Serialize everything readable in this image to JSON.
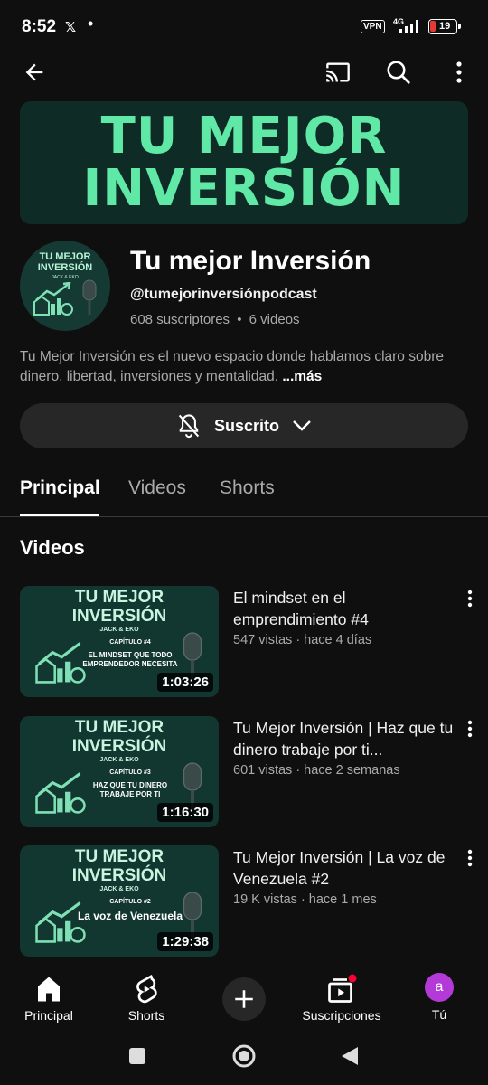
{
  "status_bar": {
    "time": "8:52",
    "x_label": "𝕏",
    "dot": "•",
    "vpn": "VPN",
    "network": "4G",
    "battery": "19",
    "battery_color": "#e53935"
  },
  "top_bar": {
    "icons": [
      "back-arrow-icon",
      "cast-icon",
      "search-icon",
      "more-vert-icon"
    ]
  },
  "banner": {
    "line1": "TU MEJOR",
    "line2": "INVERSIÓN",
    "text_color": "#5fe8a6"
  },
  "channel": {
    "avatar_line1": "TU MEJOR",
    "avatar_line2": "INVERSIÓN",
    "avatar_line3": "JACK & EKO",
    "name": "Tu mejor Inversión",
    "handle": "@tumejorinversiónpodcast",
    "subscribers": "608 suscriptores",
    "separator": "•",
    "videos_count": "6 videos",
    "description": "Tu Mejor Inversión es el nuevo espacio donde hablamos claro sobre dinero, libertad, inversiones y mentalidad.",
    "more": "...más"
  },
  "subscribe": {
    "label": "Suscrito"
  },
  "tabs": [
    {
      "label": "Principal",
      "active": true
    },
    {
      "label": "Videos",
      "active": false
    },
    {
      "label": "Shorts",
      "active": false
    }
  ],
  "section_title": "Videos",
  "videos": [
    {
      "title": "El mindset en el emprendimiento #4",
      "meta": "547 vistas · hace 4 días",
      "duration": "1:03:26",
      "thumb_line1": "TU MEJOR",
      "thumb_line2": "INVERSIÓN",
      "thumb_sub": "JACK & EKO",
      "thumb_chapter": "CAPÍTULO #4",
      "thumb_topic": "EL MINDSET QUE TODO EMPRENDEDOR NECESITA"
    },
    {
      "title": "Tu Mejor Inversión | Haz que tu dinero trabaje por ti...",
      "meta": "601 vistas · hace 2 semanas",
      "duration": "1:16:30",
      "thumb_line1": "TU MEJOR",
      "thumb_line2": "INVERSIÓN",
      "thumb_sub": "JACK & EKO",
      "thumb_chapter": "CAPÍTULO #3",
      "thumb_topic": "HAZ QUE TU DINERO TRABAJE POR TI"
    },
    {
      "title": "Tu Mejor Inversión | La voz de Venezuela #2",
      "meta": "19 K vistas · hace 1 mes",
      "duration": "1:29:38",
      "thumb_line1": "TU MEJOR",
      "thumb_line2": "INVERSIÓN",
      "thumb_sub": "JACK & EKO",
      "thumb_chapter": "CAPÍTULO #2",
      "thumb_topic": "La voz de Venezuela"
    }
  ],
  "bottom_nav": {
    "home": "Principal",
    "shorts": "Shorts",
    "subscriptions": "Suscripciones",
    "you": "Tú",
    "you_initial": "a",
    "you_color": "#b43ad8"
  }
}
